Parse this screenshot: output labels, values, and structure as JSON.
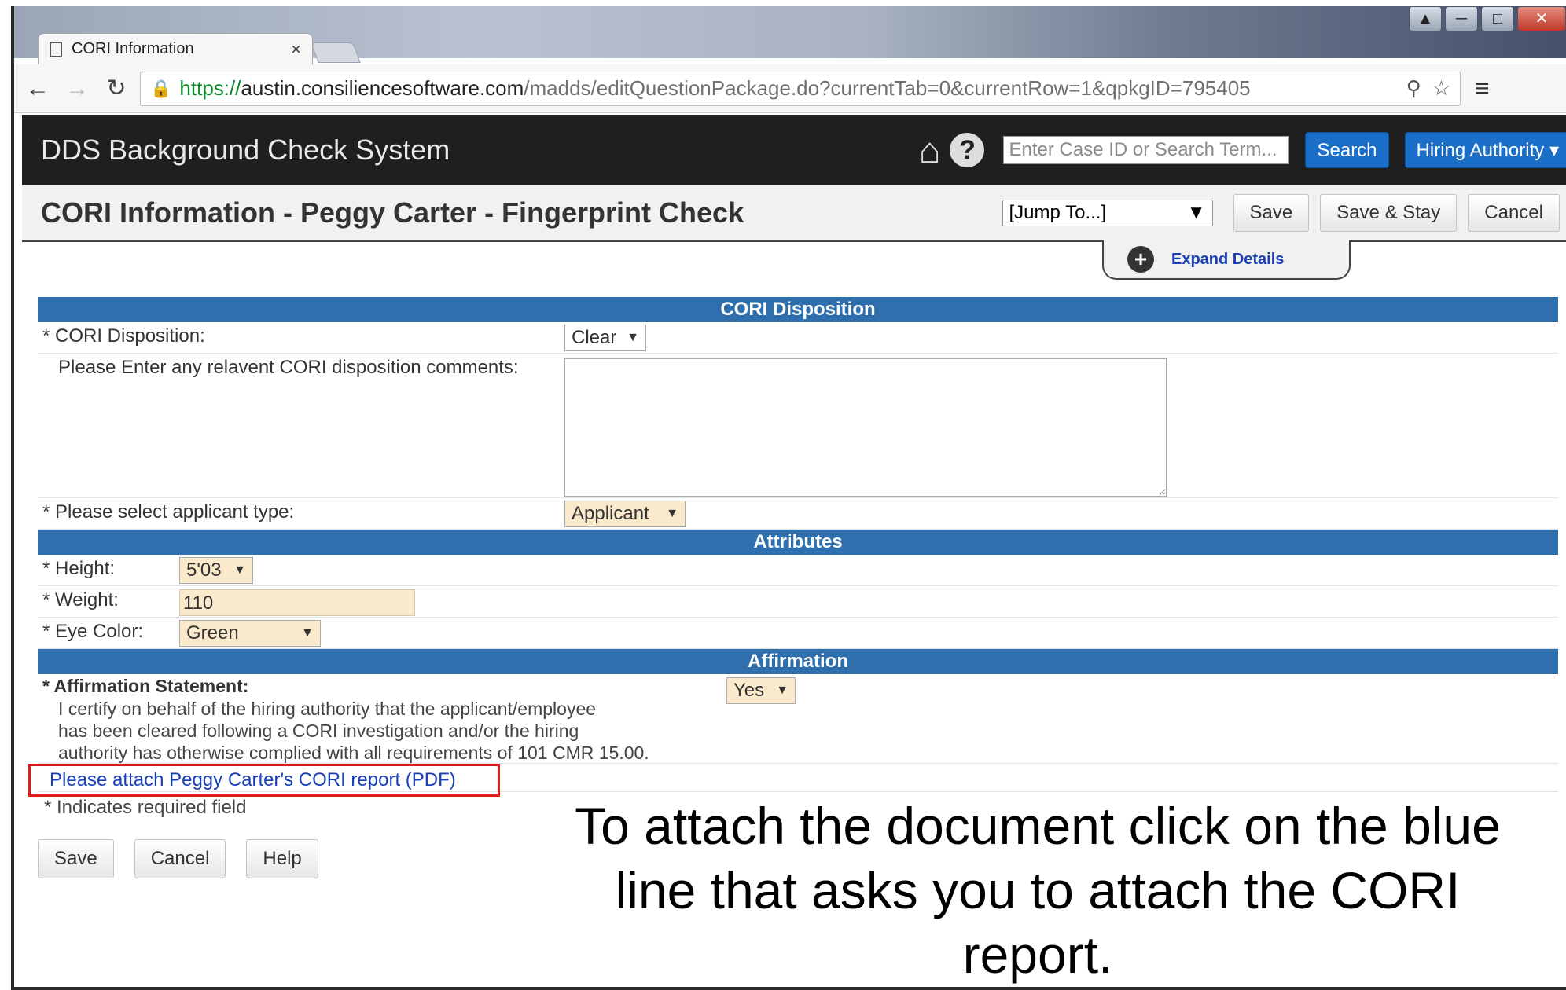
{
  "browser": {
    "tab_title": "CORI Information",
    "url": {
      "scheme": "https://",
      "host": "austin.consiliencesoftware.com",
      "path": "/madds/editQuestionPackage.do?currentTab=0&currentRow=1&qpkgID=795405"
    }
  },
  "header": {
    "app_name": "DDS Background Check System",
    "search_placeholder": "Enter Case ID or Search Term...",
    "search_label": "Search",
    "authority_label": "Hiring Authority"
  },
  "titlebar": {
    "title": "CORI Information - Peggy Carter - Fingerprint Check",
    "jump_to": "[Jump To...]",
    "save": "Save",
    "save_stay": "Save & Stay",
    "cancel": "Cancel",
    "expand_details": "Expand Details"
  },
  "cori_disposition": {
    "section_title": "CORI Disposition",
    "disposition_label": "CORI Disposition:",
    "disposition_value": "Clear",
    "comments_label": "Please Enter any relavent CORI disposition comments:",
    "comments_value": "",
    "applicant_type_label": "Please select applicant type:",
    "applicant_type_value": "Applicant"
  },
  "attributes": {
    "section_title": "Attributes",
    "height_label": "Height:",
    "height_value": "5'03",
    "weight_label": "Weight:",
    "weight_value": "110",
    "eye_color_label": "Eye Color:",
    "eye_color_value": "Green"
  },
  "affirmation": {
    "section_title": "Affirmation",
    "statement_label": "Affirmation Statement:",
    "statement_text": [
      "I certify on behalf of the hiring authority that the applicant/employee",
      "has been cleared following a CORI investigation and/or the hiring",
      "authority has otherwise complied with all requirements of 101 CMR 15.00."
    ],
    "value": "Yes",
    "attach_link": "Please attach Peggy Carter's CORI report (PDF)"
  },
  "footer": {
    "required_note": "* Indicates required field",
    "save": "Save",
    "cancel": "Cancel",
    "help": "Help"
  },
  "instruction": "To attach the document click on the blue line that asks you to attach the CORI report.",
  "colors": {
    "header_bg": "#1f1f1f",
    "section_blue": "#2f6fad",
    "button_blue": "#1c6fc9",
    "link_blue": "#1a3fb5",
    "highlight_red": "#e21b1b",
    "required_field_tan": "#fbe9cc"
  }
}
